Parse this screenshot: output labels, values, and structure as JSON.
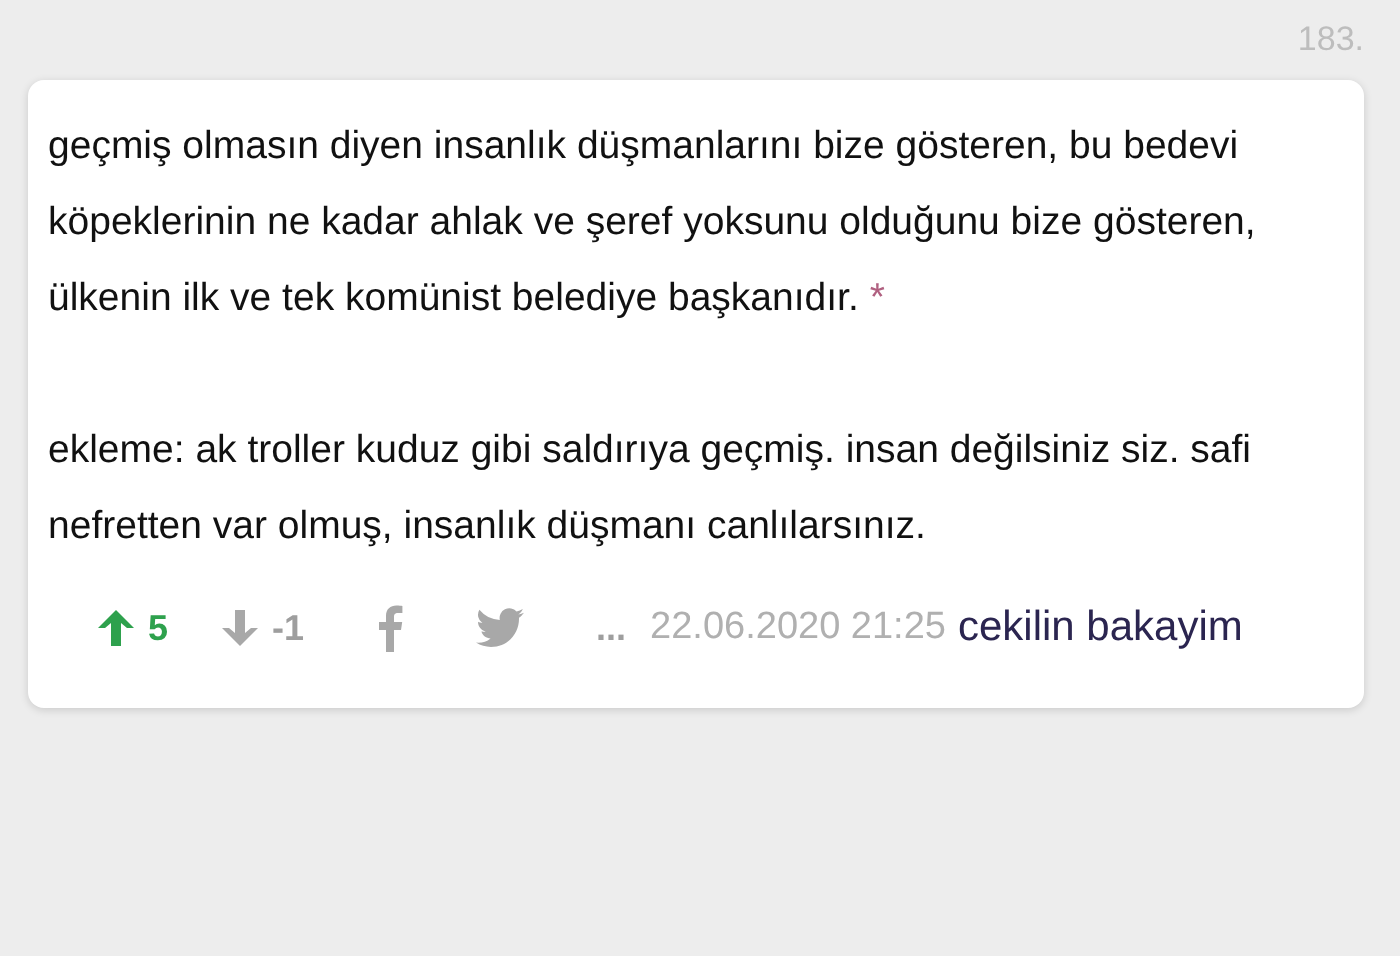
{
  "entry_number": "183.",
  "paragraphs": [
    {
      "text": "geçmiş olmasın diyen insanlık düşmanlarını bize gösteren, bu bedevi köpeklerinin ne kadar ahlak ve şeref yoksunu olduğunu bize gösteren, ülkenin ilk ve tek komünist belediye başkanıdır.",
      "link": "*"
    },
    {
      "text": "ekleme: ak troller kuduz gibi saldırıya geçmiş. insan değilsiniz siz. safi nefretten var olmuş, insanlık düşmanı canlılarsınız."
    }
  ],
  "footer": {
    "upvotes": "5",
    "downvotes": "-1",
    "more": "...",
    "date": "22.06.2020 21:25",
    "author": "cekilin bakayim"
  }
}
